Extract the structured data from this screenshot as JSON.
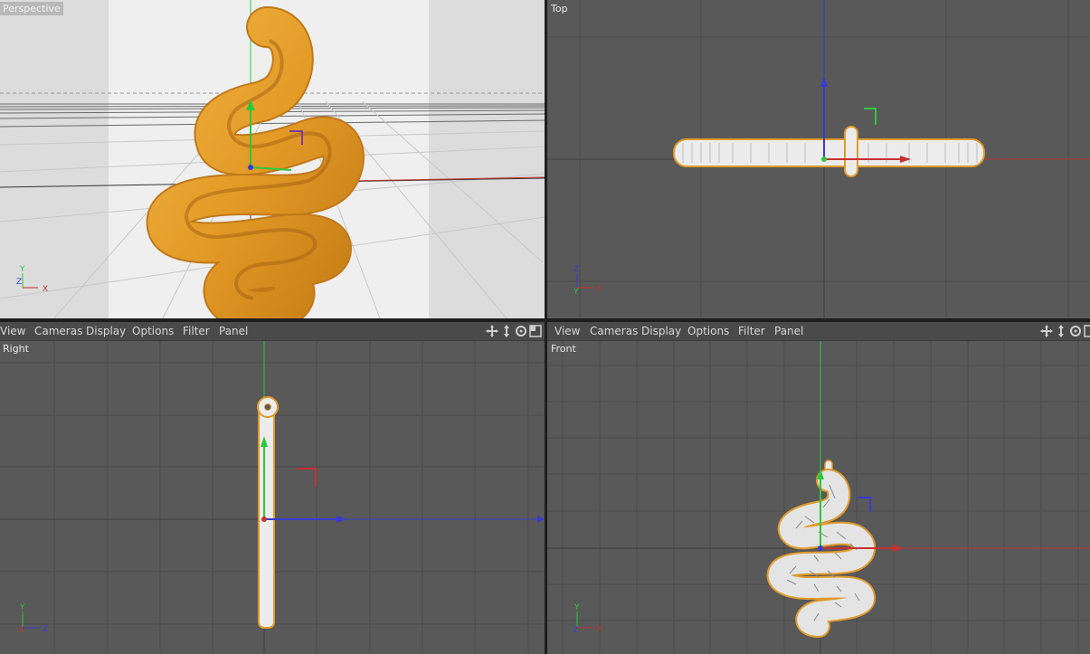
{
  "viewports": {
    "perspective": {
      "label": "Perspective"
    },
    "top": {
      "label": "Top"
    },
    "right": {
      "label": "Right"
    },
    "front": {
      "label": "Front"
    }
  },
  "menu": {
    "items": [
      "View",
      "Cameras",
      "Display",
      "Options",
      "Filter",
      "Panel"
    ]
  },
  "axes": {
    "x": "X",
    "y": "Y",
    "z": "Z"
  },
  "colors": {
    "viewport_bg": "#595959",
    "grid": "#4e4e4e",
    "gold": "#e09a2a",
    "axis_x": "#c83030",
    "axis_y": "#2cc83c",
    "axis_z": "#3a3ad0"
  },
  "icons": [
    "move-view-icon",
    "scale-view-icon",
    "rotate-view-icon",
    "maximize-view-icon"
  ]
}
